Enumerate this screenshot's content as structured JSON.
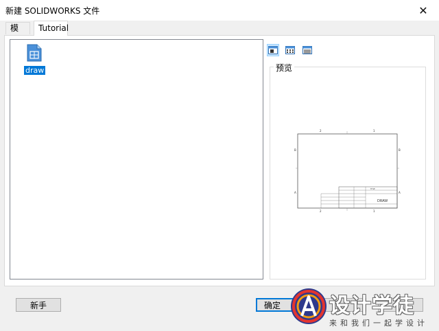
{
  "window": {
    "title": "新建 SOLIDWORKS 文件",
    "close_glyph": "✕"
  },
  "tabs": [
    {
      "label": "模板",
      "active": false
    },
    {
      "label": "Tutorial",
      "active": true
    }
  ],
  "templates": [
    {
      "label": "draw",
      "icon": "drawing-template-icon",
      "selected": true
    }
  ],
  "view_modes": [
    {
      "name": "large-icons-view-icon",
      "active": true
    },
    {
      "name": "list-view-icon",
      "active": false
    },
    {
      "name": "details-view-icon",
      "active": false
    }
  ],
  "preview": {
    "label": "预览",
    "title_block_text": "DRAW"
  },
  "buttons": {
    "novice": "新手",
    "ok": "确定",
    "cancel": "取消"
  },
  "watermark": {
    "title": "设计学徒",
    "subtitle": "来和我们一起学设计"
  }
}
